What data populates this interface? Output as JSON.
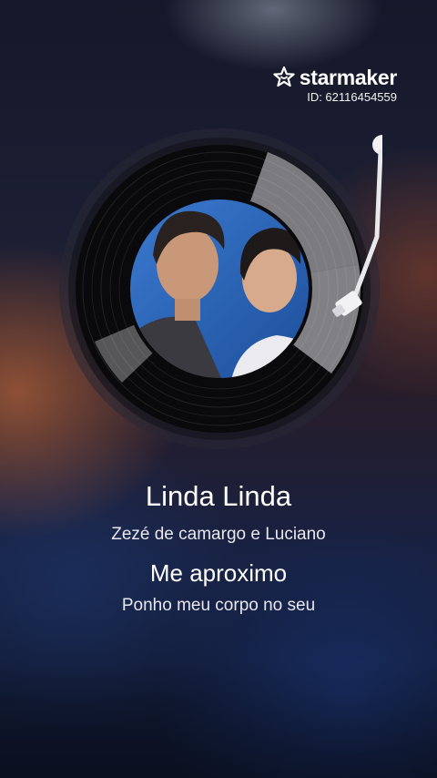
{
  "brand": {
    "name": "starmaker",
    "id_text": "ID: 62116454559",
    "icon": "starmaker-star-icon"
  },
  "player": {
    "cover_icon": "album-cover-image",
    "tonearm_icon": "tonearm-icon"
  },
  "song": {
    "title": "Linda Linda",
    "artist": "Zezé de camargo e Luciano"
  },
  "lyrics": {
    "current": "Me aproximo",
    "next": "Ponho meu corpo no seu"
  },
  "colors": {
    "text": "#ffffff",
    "cover_blue": "#2f6fc3",
    "record_black": "#0a0a0c",
    "record_highlight": "#9a9aa0"
  }
}
